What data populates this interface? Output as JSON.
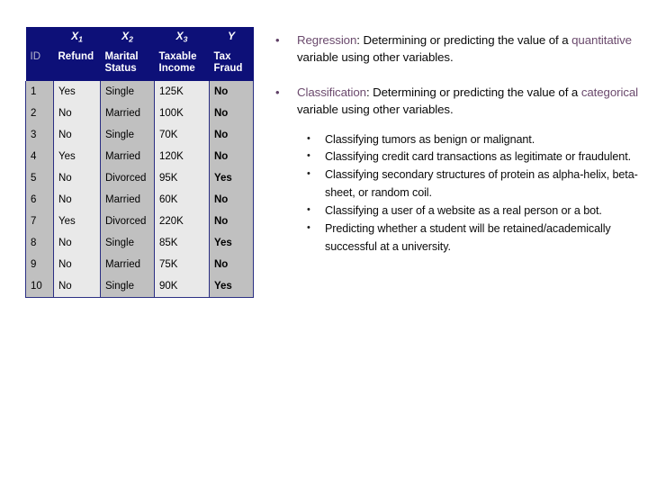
{
  "table": {
    "variable_labels": [
      "X1",
      "X2",
      "X3",
      "Y"
    ],
    "variable_labels_parts": [
      {
        "base": "X",
        "sub": "1"
      },
      {
        "base": "X",
        "sub": "2"
      },
      {
        "base": "X",
        "sub": "3"
      },
      {
        "base": "Y",
        "sub": ""
      }
    ],
    "columns": [
      "ID",
      "Refund",
      "Marital Status",
      "Taxable Income",
      "Tax Fraud"
    ],
    "column_lines": [
      [
        "ID"
      ],
      [
        "Refund"
      ],
      [
        "Marital",
        "Status"
      ],
      [
        "Taxable",
        "Income"
      ],
      [
        "Tax",
        "Fraud"
      ]
    ],
    "rows": [
      {
        "id": "1",
        "refund": "Yes",
        "marital": "Single",
        "income": "125K",
        "fraud": "No"
      },
      {
        "id": "2",
        "refund": "No",
        "marital": "Married",
        "income": "100K",
        "fraud": "No"
      },
      {
        "id": "3",
        "refund": "No",
        "marital": "Single",
        "income": "70K",
        "fraud": "No"
      },
      {
        "id": "4",
        "refund": "Yes",
        "marital": "Married",
        "income": "120K",
        "fraud": "No"
      },
      {
        "id": "5",
        "refund": "No",
        "marital": "Divorced",
        "income": "95K",
        "fraud": "Yes"
      },
      {
        "id": "6",
        "refund": "No",
        "marital": "Married",
        "income": "60K",
        "fraud": "No"
      },
      {
        "id": "7",
        "refund": "Yes",
        "marital": "Divorced",
        "income": "220K",
        "fraud": "No"
      },
      {
        "id": "8",
        "refund": "No",
        "marital": "Single",
        "income": "85K",
        "fraud": "Yes"
      },
      {
        "id": "9",
        "refund": "No",
        "marital": "Married",
        "income": "75K",
        "fraud": "No"
      },
      {
        "id": "10",
        "refund": "No",
        "marital": "Single",
        "income": "90K",
        "fraud": "Yes"
      }
    ],
    "colors": {
      "header_background": "#0d1078",
      "header_text": "#ffffff",
      "id_header_text": "#b9b9cf",
      "cell_dark": "#c0c0c0",
      "cell_light": "#e9e9e9",
      "grid_line": "#2b2f83",
      "fraud_text": "#e8130f"
    }
  },
  "content": {
    "bullets": [
      {
        "marker": "•",
        "term": "Regression",
        "after_term": ":  Determining or predicting the value of a ",
        "emphasis": "quantitative",
        "tail": " variable using other variables."
      },
      {
        "marker": "•",
        "term": "Classification",
        "after_term": ":  Determining or predicting the value of a ",
        "emphasis": "categorical",
        "tail": " variable using other variables."
      }
    ],
    "sub_bullets": [
      {
        "marker": "•",
        "text": "Classifying tumors as benign or malignant."
      },
      {
        "marker": "•",
        "text": "Classifying credit card transactions as legitimate or fraudulent."
      },
      {
        "marker": "•",
        "text": "Classifying secondary structures of protein as alpha-helix, beta-sheet, or random coil."
      },
      {
        "marker": "•",
        "text": "Classifying a user of a website as a real person or a bot."
      },
      {
        "marker": "•",
        "text": "Predicting whether a student will be retained/academically successful at a university."
      }
    ],
    "colors": {
      "accent_purple": "#6b4a6d",
      "bullet_purple": "#5f3f66",
      "body_text": "#0a0a0a"
    }
  }
}
